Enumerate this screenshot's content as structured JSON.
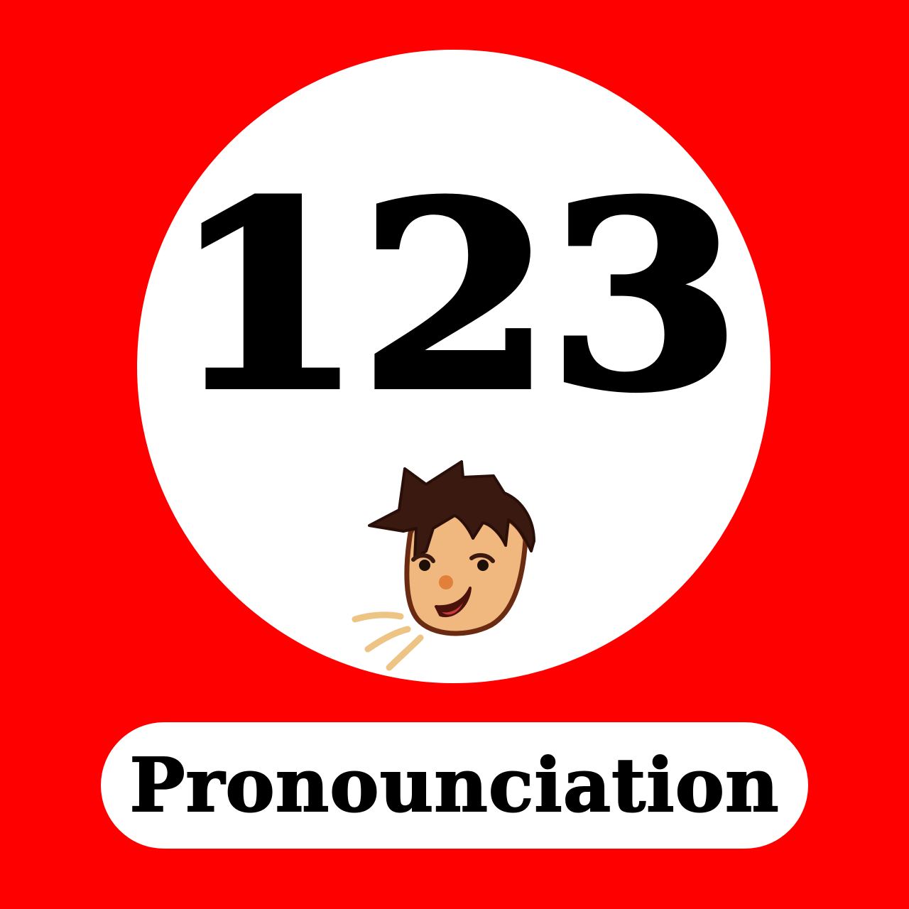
{
  "icon": {
    "background_color": "#ff0000",
    "circle_color": "#ffffff",
    "number_text": "123",
    "label_text": "Pronounciation",
    "speaker_icon": "speaking-head-icon"
  }
}
